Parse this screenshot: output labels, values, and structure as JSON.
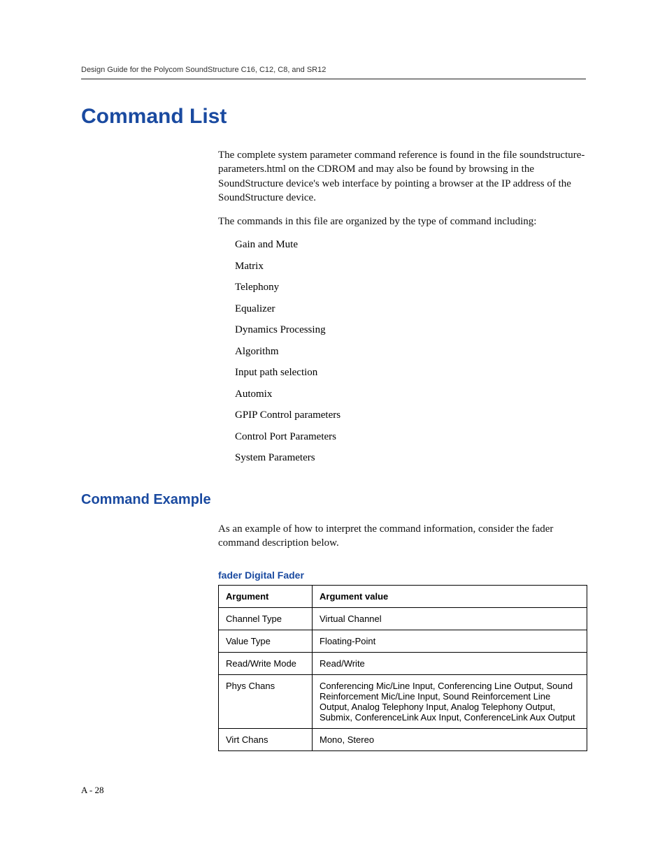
{
  "header": {
    "running": "Design Guide for the Polycom SoundStructure C16, C12, C8, and SR12"
  },
  "title": "Command List",
  "intro": {
    "p1": "The complete system parameter command reference is found in the file soundstructure-parameters.html on the CDROM and may also be found by browsing in the SoundStructure device's web interface by pointing a browser at the IP address of the SoundStructure device.",
    "p2": "The commands in this file are organized by the type of command including:"
  },
  "command_types": [
    "Gain and Mute",
    "Matrix",
    "Telephony",
    "Equalizer",
    "Dynamics Processing",
    "Algorithm",
    "Input path selection",
    "Automix",
    "GPIP Control parameters",
    "Control Port Parameters",
    "System Parameters"
  ],
  "example": {
    "heading": "Command Example",
    "p1": "As an example of how to interpret the command information, consider the fader command description below.",
    "table_title": "fader Digital Fader",
    "table": {
      "headers": [
        "Argument",
        "Argument value"
      ],
      "rows": [
        {
          "arg": "Channel Type",
          "val": "Virtual Channel"
        },
        {
          "arg": "Value Type",
          "val": "Floating-Point"
        },
        {
          "arg": "Read/Write Mode",
          "val": "Read/Write"
        },
        {
          "arg": "Phys Chans",
          "val": "Conferencing Mic/Line Input, Conferencing Line Output, Sound Reinforcement Mic/Line Input, Sound Reinforcement Line Output, Analog Telephony Input, Analog Telephony Output, Submix, ConferenceLink Aux Input, ConferenceLink Aux Output"
        },
        {
          "arg": "Virt Chans",
          "val": "Mono, Stereo"
        }
      ]
    }
  },
  "page_number": "A - 28"
}
